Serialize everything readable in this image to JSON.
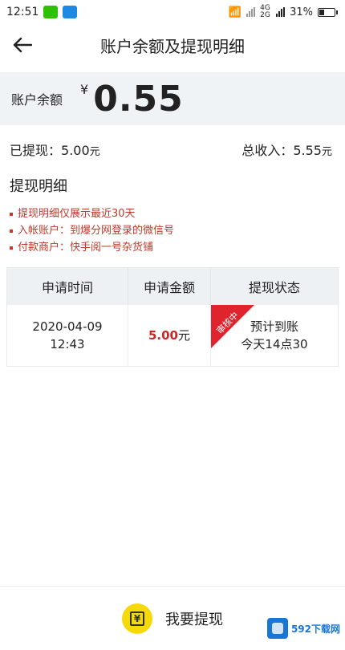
{
  "status_bar": {
    "time": "12:51",
    "network": "4G 2G",
    "battery": "31%"
  },
  "header": {
    "title": "账户余额及提现明细"
  },
  "balance": {
    "label": "账户余额",
    "currency": "¥",
    "amount": "0.55"
  },
  "summary": {
    "withdrawn_label": "已提现：",
    "withdrawn_value": "5.00",
    "withdrawn_unit": "元",
    "income_label": "总收入：",
    "income_value": "5.55",
    "income_unit": "元"
  },
  "section_title": "提现明细",
  "notes": [
    "提现明细仅展示最近30天",
    "入帐账户：到爆分网登录的微信号",
    "付款商户：快手阅一号杂货铺"
  ],
  "table": {
    "headers": [
      "申请时间",
      "申请金额",
      "提现状态"
    ],
    "rows": [
      {
        "date": "2020-04-09",
        "time": "12:43",
        "amount": "5.00",
        "unit": "元",
        "ribbon": "审核中",
        "status_line1": "预计到账",
        "status_line2": "今天14点30"
      }
    ]
  },
  "bottom": {
    "label": "我要提现"
  },
  "watermark": {
    "text": "592下载网"
  },
  "colors": {
    "accent_red": "#c62828",
    "ribbon": "#e0242d",
    "button_yellow": "#f5d90a"
  }
}
